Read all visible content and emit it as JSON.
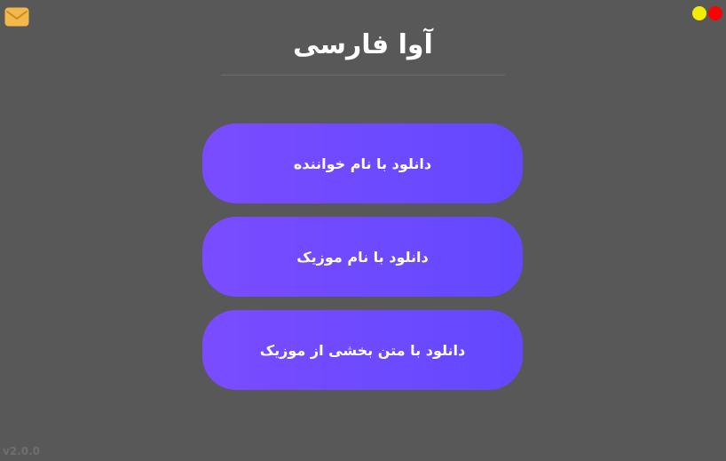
{
  "app": {
    "title": "آوا فارسی",
    "version": "v2.0.0"
  },
  "icons": {
    "mail": "mail-icon",
    "minimize": "minimize-dot",
    "close": "close-dot"
  },
  "colors": {
    "background": "#585858",
    "button_gradient_start": "#7a4cff",
    "button_gradient_end": "#6348ff",
    "minimize": "#f2ec00",
    "close": "#ff0000",
    "mail_icon": "#f2b84b"
  },
  "menu": {
    "items": [
      {
        "label": "دانلود با نام خواننده"
      },
      {
        "label": "دانلود با نام موزیک"
      },
      {
        "label": "دانلود با متن بخشی از موزیک"
      }
    ]
  }
}
